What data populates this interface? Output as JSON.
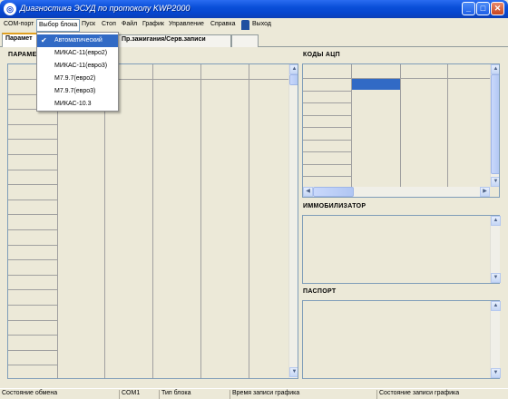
{
  "window": {
    "icon": "app-logo-icon",
    "title": "Диагностика ЭСУД по протоколу KWP2000",
    "minimize": "_",
    "maximize": "□",
    "close": "✕"
  },
  "menu": {
    "items": [
      "COM-порт",
      "Выбор блока",
      "Пуск",
      "Стоп",
      "Файл",
      "График",
      "Управление",
      "Справка"
    ],
    "exit_label": "Выход",
    "exit_icon": "exit-door-icon"
  },
  "tabs": [
    {
      "label": "Парамет"
    },
    {
      "label": "Пр.зажигания/Серв.записи"
    }
  ],
  "dropdown": {
    "items": [
      {
        "label": "Автоматический",
        "checked": true
      },
      {
        "label": "МИКАС-11(евро2)"
      },
      {
        "label": "МИКАС-11(евро3)"
      },
      {
        "label": "M7.9.7(евро2)"
      },
      {
        "label": "M7.9.7(евро3)"
      },
      {
        "label": "МИКАС-10.3"
      }
    ]
  },
  "panels": {
    "params_label": "ПАРАМЕ",
    "adc_label": "КОДЫ АЦП",
    "immo_label": "ИММОБИЛИЗАТОР",
    "passport_label": "ПАСПОРТ"
  },
  "statusbar": {
    "cells": [
      "Состояние обмена",
      "COM1",
      "Тип блока",
      "Время записи графика",
      "Состояние записи графика"
    ]
  },
  "colors": {
    "titlebar": "#0a4fd8",
    "selection": "#316ac5",
    "face": "#ece9d8",
    "grid_line": "#a0a0a0"
  }
}
